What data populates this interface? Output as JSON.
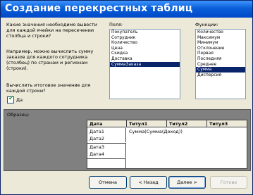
{
  "window": {
    "title": "Создание перекрестных таблиц"
  },
  "question1": "Какие значения необходимо вывести для каждой ячейки на пересечении столбца и строки?",
  "question2": "Например, можно вычислить сумму заказов для каждого сотрудника (столбец) по странам и регионам (строки).",
  "question3": "Вычислить итоговое значение для каждой строки?",
  "checkbox": {
    "label": "Да",
    "checked": true
  },
  "fields": {
    "label": "Поля:",
    "items": [
      "Покупатель",
      "Сотрудник",
      "Количество",
      "Цена",
      "Скидка",
      "Доставка",
      "СуммаЗаказа"
    ],
    "selected": 6
  },
  "functions": {
    "label": "Функции:",
    "items": [
      "Количество",
      "Максимум",
      "Минимум",
      "Отклонение",
      "Первая",
      "Последняя",
      "Среднее",
      "Сумма",
      "Дисперсия"
    ],
    "selected": 7
  },
  "sample": {
    "label": "Образец:",
    "headers": [
      "Дата",
      "Титул1",
      "Титул2",
      "Титул3"
    ],
    "rows": [
      "Дата1",
      "Дата2",
      "Дата3",
      "Дата4"
    ],
    "cell_value": "Сумма(Сумма(Доход))"
  },
  "buttons": {
    "cancel": "Отмена",
    "back": "< Назад",
    "next": "Далее >",
    "finish": "Готово"
  }
}
